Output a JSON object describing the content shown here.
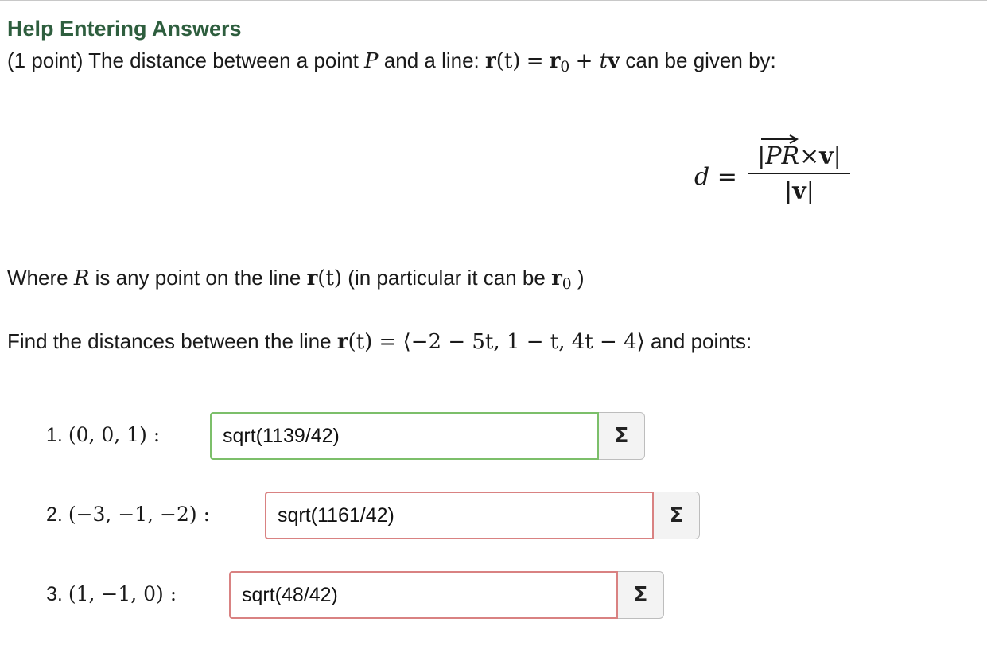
{
  "header": {
    "help_link": "Help Entering Answers"
  },
  "intro": {
    "prefix": "(1 point) The distance between a point",
    "point_var": "P",
    "and_line": "and a line:",
    "r_bold": "r",
    "t_arg": "(t)",
    "equals": "=",
    "r0": "r",
    "sub0": "0",
    "plus_t": "+ t",
    "v_bold": "v",
    "suffix": "can be given by:"
  },
  "formula": {
    "lhs": "d =",
    "num_pr": "PR",
    "num_times": "×",
    "num_v": "v",
    "den_v": "v",
    "bar": "|"
  },
  "where": {
    "prefix": "Where",
    "var_r": "R",
    "mid": "is any point on the line",
    "r_bold": "r",
    "t_arg": "(t)",
    "paren_text": "(in particular it can be",
    "r0": "r",
    "sub0": "0",
    "close": ")"
  },
  "find": {
    "prefix": "Find the distances between the line",
    "r_bold": "r",
    "expr": "(t) = ⟨−2 − 5t, 1 − t, 4t − 4⟩",
    "suffix": "and points:"
  },
  "questions": [
    {
      "num": "1.",
      "point": "(0, 0, 1) :",
      "answer": "sqrt(1139/42)",
      "status": "correct"
    },
    {
      "num": "2.",
      "point": "(−3, −1, −2) :",
      "answer": "sqrt(1161/42)",
      "status": "incorrect"
    },
    {
      "num": "3.",
      "point": "(1, −1, 0) :",
      "answer": "sqrt(48/42)",
      "status": "incorrect"
    }
  ],
  "equation_button": {
    "symbol": "Σ"
  },
  "colors": {
    "correct_border": "#7cbf6a",
    "incorrect_border": "#d98282",
    "link": "#2e5e3e"
  }
}
